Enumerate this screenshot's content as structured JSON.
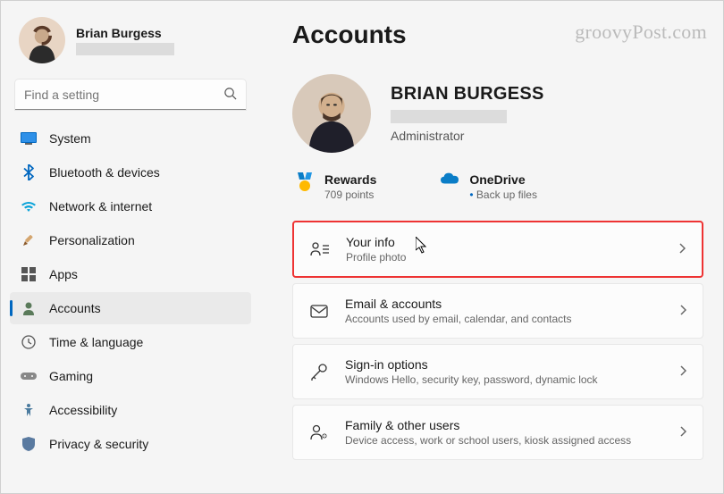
{
  "profile": {
    "name": "Brian Burgess"
  },
  "search": {
    "placeholder": "Find a setting"
  },
  "sidebar": {
    "items": [
      {
        "label": "System"
      },
      {
        "label": "Bluetooth & devices"
      },
      {
        "label": "Network & internet"
      },
      {
        "label": "Personalization"
      },
      {
        "label": "Apps"
      },
      {
        "label": "Accounts"
      },
      {
        "label": "Time & language"
      },
      {
        "label": "Gaming"
      },
      {
        "label": "Accessibility"
      },
      {
        "label": "Privacy & security"
      }
    ]
  },
  "page": {
    "title": "Accounts"
  },
  "hero": {
    "name": "BRIAN BURGESS",
    "role": "Administrator"
  },
  "info": {
    "rewards": {
      "title": "Rewards",
      "sub": "709 points"
    },
    "onedrive": {
      "title": "OneDrive",
      "sub": "Back up files"
    }
  },
  "cards": {
    "yourinfo": {
      "title": "Your info",
      "sub": "Profile photo"
    },
    "email": {
      "title": "Email & accounts",
      "sub": "Accounts used by email, calendar, and contacts"
    },
    "signin": {
      "title": "Sign-in options",
      "sub": "Windows Hello, security key, password, dynamic lock"
    },
    "family": {
      "title": "Family & other users",
      "sub": "Device access, work or school users, kiosk assigned access"
    }
  },
  "watermark": "groovyPost.com"
}
